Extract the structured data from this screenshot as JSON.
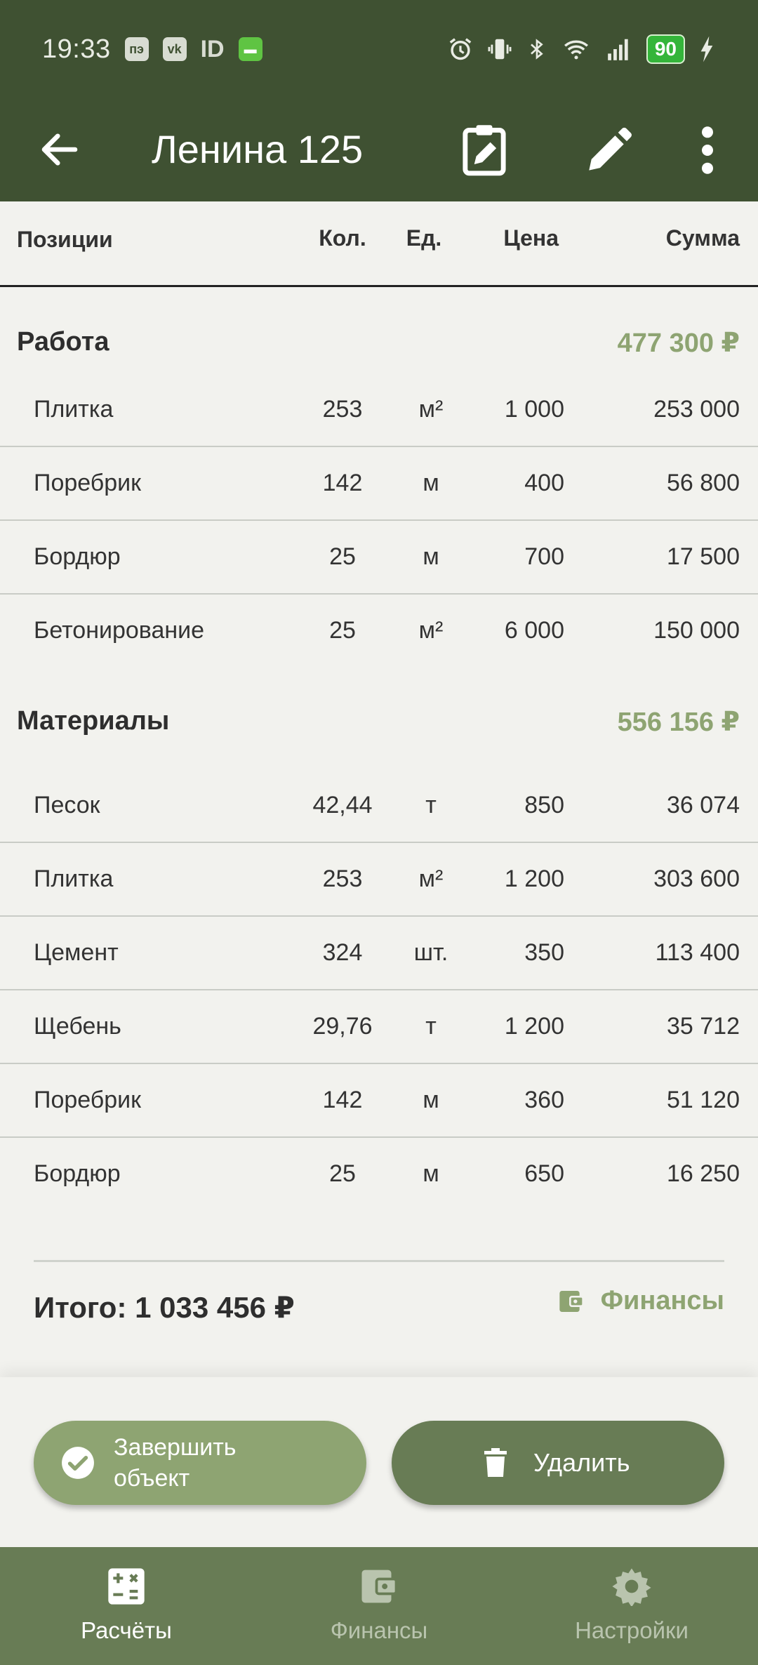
{
  "status_bar": {
    "time": "19:33",
    "id_label": "ID",
    "battery": "90",
    "icons": [
      "pe-icon",
      "vk-icon",
      "id-icon",
      "message-icon",
      "alarm-icon",
      "vibrate-icon",
      "bluetooth-icon",
      "wifi-icon",
      "signal-icon",
      "battery-icon",
      "charging-icon"
    ]
  },
  "app_bar": {
    "title": "Ленина 125",
    "icons": [
      "back-arrow-icon",
      "clipboard-edit-icon",
      "pencil-icon",
      "more-vert-icon"
    ]
  },
  "columns": {
    "name": "Позиции",
    "qty": "Кол.",
    "unit": "Ед.",
    "price": "Цена",
    "sum": "Сумма"
  },
  "sections": [
    {
      "title": "Работа",
      "total": "477 300 ₽",
      "rows": [
        {
          "name": "Плитка",
          "qty": "253",
          "unit": "м²",
          "price": "1 000",
          "sum": "253 000"
        },
        {
          "name": "Поребрик",
          "qty": "142",
          "unit": "м",
          "price": "400",
          "sum": "56 800"
        },
        {
          "name": "Бордюр",
          "qty": "25",
          "unit": "м",
          "price": "700",
          "sum": "17 500"
        },
        {
          "name": "Бетонирование",
          "qty": "25",
          "unit": "м²",
          "price": "6 000",
          "sum": "150 000"
        }
      ]
    },
    {
      "title": "Материалы",
      "total": "556 156 ₽",
      "rows": [
        {
          "name": "Песок",
          "qty": "42,44",
          "unit": "т",
          "price": "850",
          "sum": "36 074"
        },
        {
          "name": "Плитка",
          "qty": "253",
          "unit": "м²",
          "price": "1 200",
          "sum": "303 600"
        },
        {
          "name": "Цемент",
          "qty": "324",
          "unit": "шт.",
          "price": "350",
          "sum": "113 400"
        },
        {
          "name": "Щебень",
          "qty": "29,76",
          "unit": "т",
          "price": "1 200",
          "sum": "35 712"
        },
        {
          "name": "Поребрик",
          "qty": "142",
          "unit": "м",
          "price": "360",
          "sum": "51 120"
        },
        {
          "name": "Бордюр",
          "qty": "25",
          "unit": "м",
          "price": "650",
          "sum": "16 250"
        }
      ]
    }
  ],
  "total": "Итого: 1 033 456 ₽",
  "finance_link": "Финансы",
  "buttons": {
    "complete": "Завершить объект",
    "delete": "Удалить"
  },
  "bottom_nav": [
    {
      "label": "Расчёты",
      "icon": "calculator-icon",
      "active": true
    },
    {
      "label": "Финансы",
      "icon": "wallet-icon",
      "active": false
    },
    {
      "label": "Настройки",
      "icon": "gear-icon",
      "active": false
    }
  ],
  "colors": {
    "appbar": "#3f5132",
    "accent": "#8ea472",
    "nav": "#687c55",
    "background": "#f2f2ee"
  }
}
